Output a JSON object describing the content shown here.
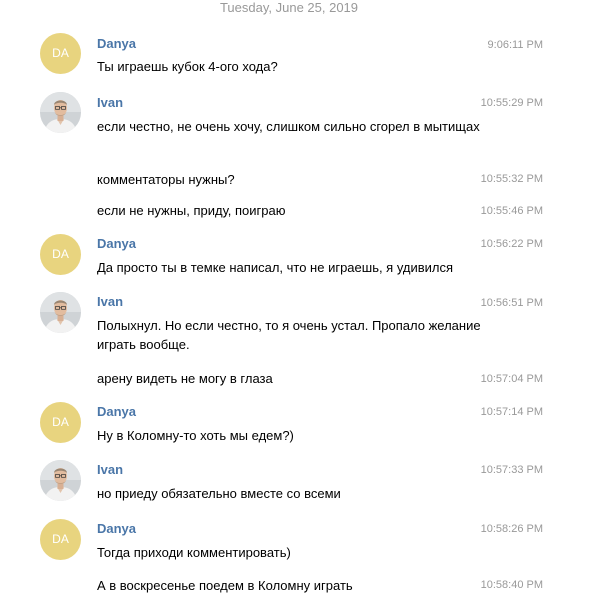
{
  "date_header": "Tuesday, June 25, 2019",
  "avatars": {
    "danya_initials": "DA"
  },
  "colors": {
    "sender_name": "#4a76a8",
    "avatar_bg": "#e8d47f",
    "timestamp": "#999999"
  },
  "messages": [
    {
      "sender": "Danya",
      "time": "9:06:11 PM",
      "text": "Ты играешь кубок 4-ого хода?"
    },
    {
      "sender": "Ivan",
      "time": "10:55:29 PM",
      "text": "если честно, не очень хочу, слишком сильно сгорел в мытищах"
    },
    {
      "time": "10:55:32 PM",
      "text": "комментаторы нужны?"
    },
    {
      "time": "10:55:46 PM",
      "text": "если не нужны, приду, поиграю"
    },
    {
      "sender": "Danya",
      "time": "10:56:22 PM",
      "text": "Да просто ты в темке написал, что не играешь, я удивился"
    },
    {
      "sender": "Ivan",
      "time": "10:56:51 PM",
      "text": "Полыхнул. Но если честно, то я очень устал. Пропало желание играть вообще."
    },
    {
      "time": "10:57:04 PM",
      "text": "арену видеть не могу в глаза"
    },
    {
      "sender": "Danya",
      "time": "10:57:14 PM",
      "text": "Ну в Коломну-то хоть мы едем?)"
    },
    {
      "sender": "Ivan",
      "time": "10:57:33 PM",
      "text": "но приеду обязательно вместе со всеми"
    },
    {
      "sender": "Danya",
      "time": "10:58:26 PM",
      "text": "Тогда приходи комментировать)"
    },
    {
      "time": "10:58:40 PM",
      "text": "А в воскресенье поедем в Коломну играть"
    }
  ]
}
